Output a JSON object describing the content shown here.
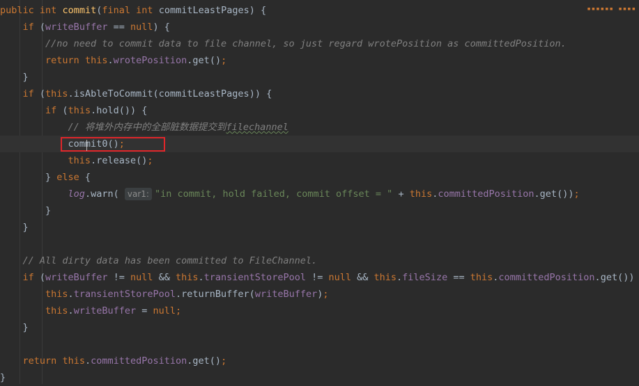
{
  "code": {
    "l1_public": "public",
    "l1_int": "int",
    "l1_name": "commit",
    "l1_final": "final",
    "l1_int2": "int",
    "l1_param": "commitLeastPages",
    "l2_if": "if",
    "l2_field": "writeBuffer",
    "l2_null": "null",
    "l3_comment": "//no need to commit data to file channel, so just regard wrotePosition as committedPosition.",
    "l4_return": "return",
    "l4_this": "this",
    "l4_field": "wrotePosition",
    "l4_get": "get",
    "l6_if": "if",
    "l6_this": "this",
    "l6_method": "isAbleToCommit",
    "l6_arg": "commitLeastPages",
    "l7_if": "if",
    "l7_this": "this",
    "l7_method": "hold",
    "l8_comment_a": "// 将堆外内存中的全部脏数据提交到",
    "l8_comment_b": "filechannel",
    "l9_call": "commit0",
    "l10_this": "this",
    "l10_method": "release",
    "l11_else": "else",
    "l12_log": "log",
    "l12_warn": "warn",
    "l12_hint": "var1:",
    "l12_str": "\"in commit, hold failed, commit offset = \"",
    "l12_this": "this",
    "l12_field": "committedPosition",
    "l12_get": "get",
    "l16_comment": "// All dirty data has been committed to FileChannel.",
    "l17_if": "if",
    "l17_f1": "writeBuffer",
    "l17_null": "null",
    "l17_this1": "this",
    "l17_f2": "transientStorePool",
    "l17_null2": "null",
    "l17_this2": "this",
    "l17_f3": "fileSize",
    "l17_this3": "this",
    "l17_f4": "committedPosition",
    "l17_get": "get",
    "l18_this": "this",
    "l18_field": "transientStorePool",
    "l18_method": "returnBuffer",
    "l18_arg": "writeBuffer",
    "l19_this": "this",
    "l19_field": "writeBuffer",
    "l19_null": "null",
    "l22_return": "return",
    "l22_this": "this",
    "l22_field": "committedPosition",
    "l22_get": "get"
  },
  "colors": {
    "background": "#2b2b2b",
    "keyword": "#cc7832",
    "function": "#ffc66d",
    "field": "#9876aa",
    "string": "#6a8759",
    "comment": "#808080",
    "highlight_box": "#e0262a"
  }
}
